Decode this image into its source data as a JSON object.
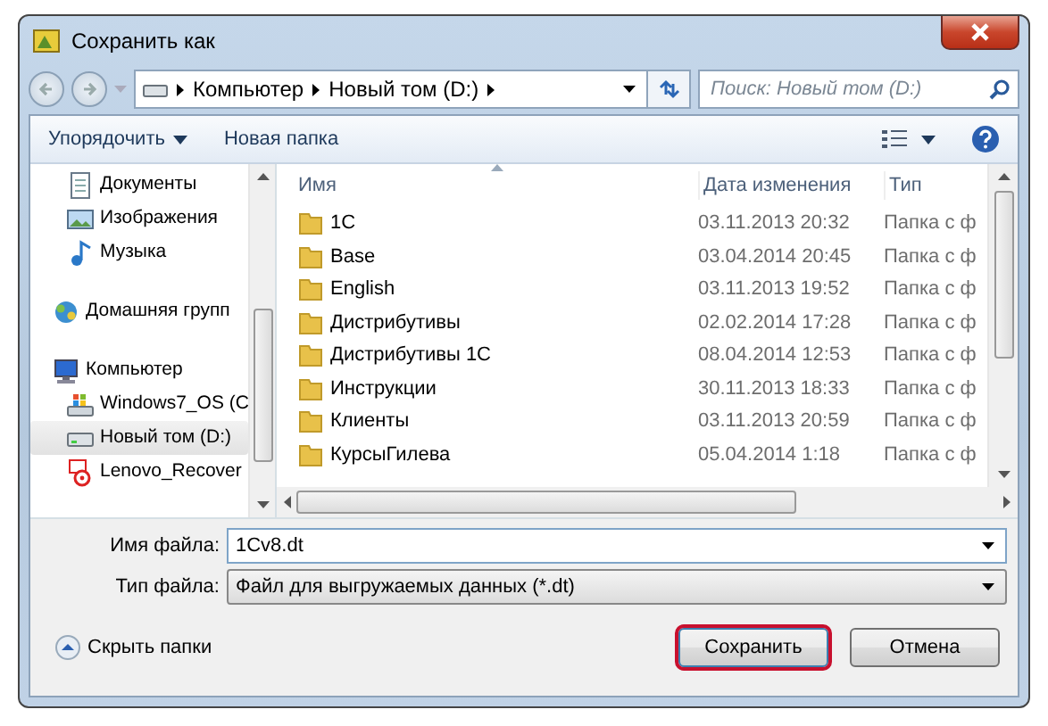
{
  "window": {
    "title": "Сохранить как"
  },
  "breadcrumb": [
    "Компьютер",
    "Новый том (D:)"
  ],
  "search": {
    "placeholder": "Поиск: Новый том (D:)"
  },
  "toolbar": {
    "organize": "Упорядочить",
    "new_folder": "Новая папка"
  },
  "nav": [
    {
      "items": [
        {
          "label": "Документы",
          "kind": "documents",
          "selected": false
        },
        {
          "label": "Изображения",
          "kind": "pictures",
          "selected": false
        },
        {
          "label": "Музыка",
          "kind": "music",
          "selected": false
        }
      ]
    },
    {
      "items": [
        {
          "label": "Домашняя групп",
          "kind": "homegroup",
          "selected": false
        }
      ]
    },
    {
      "items": [
        {
          "label": "Компьютер",
          "kind": "computer",
          "selected": false,
          "children": [
            {
              "label": "Windows7_OS (C",
              "kind": "osdrive",
              "selected": false
            },
            {
              "label": "Новый том (D:)",
              "kind": "drive",
              "selected": true
            },
            {
              "label": "Lenovo_Recover",
              "kind": "recovery",
              "selected": false
            }
          ]
        }
      ]
    }
  ],
  "columns": [
    {
      "label": "Имя",
      "sorted": true
    },
    {
      "label": "Дата изменения",
      "sorted": false
    },
    {
      "label": "Тип",
      "sorted": false
    }
  ],
  "rows": [
    {
      "name": "1C",
      "date": "03.11.2013 20:32",
      "type": "Папка с ф"
    },
    {
      "name": "Base",
      "date": "03.04.2014 20:45",
      "type": "Папка с ф"
    },
    {
      "name": "English",
      "date": "03.11.2013 19:52",
      "type": "Папка с ф"
    },
    {
      "name": "Дистрибутивы",
      "date": "02.02.2014 17:28",
      "type": "Папка с ф"
    },
    {
      "name": "Дистрибутивы 1С",
      "date": "08.04.2014 12:53",
      "type": "Папка с ф"
    },
    {
      "name": "Инструкции",
      "date": "30.11.2013 18:33",
      "type": "Папка с ф"
    },
    {
      "name": "Клиенты",
      "date": "03.11.2013 20:59",
      "type": "Папка с ф"
    },
    {
      "name": "КурсыГилева",
      "date": "05.04.2014 1:18",
      "type": "Папка с ф"
    }
  ],
  "fields": [
    {
      "label": "Имя файла:",
      "value": "1Cv8.dt",
      "kind": "combo"
    },
    {
      "label": "Тип файла:",
      "value": "Файл для выгружаемых данных (*.dt)",
      "kind": "select"
    }
  ],
  "hide_folders": "Скрыть папки",
  "buttons": [
    {
      "label": "Сохранить",
      "default": true
    },
    {
      "label": "Отмена",
      "default": false
    }
  ]
}
